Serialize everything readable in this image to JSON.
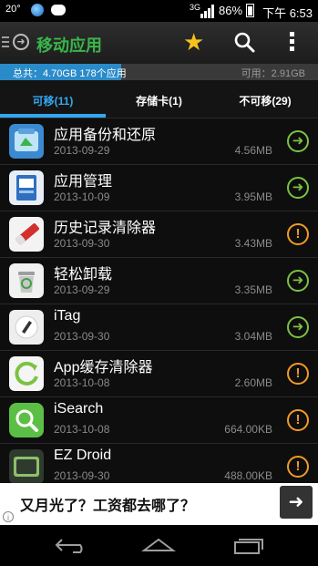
{
  "status_bar": {
    "temperature": "20°",
    "network": "3G",
    "battery": "86%",
    "time": "下午 6:53"
  },
  "header": {
    "title": "移动应用",
    "icons": [
      "menu-icon",
      "back-circle-icon",
      "star-icon",
      "search-icon",
      "more-icon"
    ]
  },
  "storage": {
    "total_label": "总共：4.70GB 178个应用",
    "available_label": "可用：2.91GB",
    "used_fraction": 0.38
  },
  "tabs": [
    {
      "label": "可移(11)",
      "active": true
    },
    {
      "label": "存储卡(1)",
      "active": false
    },
    {
      "label": "不可移(29)",
      "active": false
    }
  ],
  "apps": [
    {
      "name": "应用备份和还原",
      "date": "2013-09-29",
      "size": "4.56MB",
      "action": "move"
    },
    {
      "name": "应用管理",
      "date": "2013-10-09",
      "size": "3.95MB",
      "action": "move"
    },
    {
      "name": "历史记录清除器",
      "date": "2013-09-30",
      "size": "3.43MB",
      "action": "warn"
    },
    {
      "name": "轻松卸载",
      "date": "2013-09-29",
      "size": "3.35MB",
      "action": "move"
    },
    {
      "name": "iTag",
      "date": "2013-09-30",
      "size": "3.04MB",
      "action": "move"
    },
    {
      "name": "App缓存清除器",
      "date": "2013-10-08",
      "size": "2.60MB",
      "action": "warn"
    },
    {
      "name": "iSearch",
      "date": "2013-10-08",
      "size": "664.00KB",
      "action": "warn"
    },
    {
      "name": "EZ Droid",
      "date": "2013-09-30",
      "size": "488.00KB",
      "action": "warn"
    }
  ],
  "ad": {
    "text": "又月光了？工资都去哪了？",
    "button_icon": "arrow-right-icon"
  },
  "colors": {
    "accent": "#35a7f0",
    "title_green": "#3ab54a",
    "move_green": "#7cc242",
    "warn_orange": "#f19a2a"
  }
}
